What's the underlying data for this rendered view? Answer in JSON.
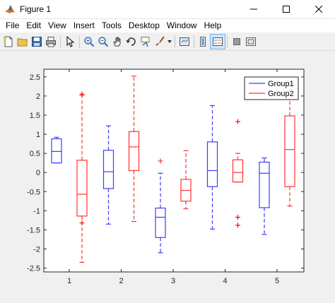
{
  "window": {
    "title": "Figure 1"
  },
  "menu": [
    "File",
    "Edit",
    "View",
    "Insert",
    "Tools",
    "Desktop",
    "Window",
    "Help"
  ],
  "toolbar": [
    "new-file-icon",
    "open-folder-icon",
    "save-icon",
    "print-icon",
    "pointer-icon",
    "zoom-in-icon",
    "zoom-out-icon",
    "pan-icon",
    "rotate-3d-icon",
    "data-cursor-icon",
    "brush-icon",
    "link-plot-icon",
    "colorbar-icon",
    "legend-icon",
    "hide-plot-tools-icon",
    "show-plot-tools-icon"
  ],
  "colors": {
    "group1": "#3c3cff",
    "group2": "#ff3333",
    "outlier2": "#ff0000"
  },
  "chart_data": {
    "type": "box",
    "xlabel": "",
    "ylabel": "",
    "categories": [
      "1",
      "2",
      "3",
      "4",
      "5"
    ],
    "ylim": [
      -2.6,
      2.7
    ],
    "yticks": [
      "-2.5",
      "-2",
      "-1.5",
      "-1",
      "-0.5",
      "0",
      "0.5",
      "1",
      "1.5",
      "2",
      "2.5"
    ],
    "yticks_values": [
      -2.5,
      -2,
      -1.5,
      -1,
      -0.5,
      0,
      0.5,
      1,
      1.5,
      2,
      2.5
    ],
    "legend": {
      "position": "top-right",
      "entries": [
        "Group1",
        "Group2"
      ]
    },
    "series": [
      {
        "name": "Group1",
        "boxes": [
          {
            "category": "1",
            "min": 0.25,
            "q1": 0.25,
            "median": 0.55,
            "q3": 0.88,
            "max": 0.92,
            "outliers": []
          },
          {
            "category": "2",
            "min": -1.35,
            "q1": -0.42,
            "median": 0.02,
            "q3": 0.58,
            "max": 1.22,
            "outliers": []
          },
          {
            "category": "3",
            "min": -2.1,
            "q1": -1.7,
            "median": -1.17,
            "q3": -0.93,
            "max": -0.02,
            "outliers": [
              0.3
            ]
          },
          {
            "category": "4",
            "min": -1.48,
            "q1": -0.37,
            "median": 0.05,
            "q3": 0.8,
            "max": 1.75,
            "outliers": []
          },
          {
            "category": "5",
            "min": -1.62,
            "q1": -0.92,
            "median": -0.02,
            "q3": 0.27,
            "max": 0.38,
            "outliers": []
          }
        ]
      },
      {
        "name": "Group2",
        "boxes": [
          {
            "category": "1",
            "min": -2.35,
            "q1": -1.14,
            "median": -0.57,
            "q3": 0.32,
            "max": 2.02,
            "outliers": [
              2.05,
              -1.32
            ]
          },
          {
            "category": "2",
            "min": -1.28,
            "q1": 0.05,
            "median": 0.67,
            "q3": 1.07,
            "max": 2.52,
            "outliers": []
          },
          {
            "category": "3",
            "min": -0.95,
            "q1": -0.75,
            "median": -0.47,
            "q3": -0.18,
            "max": 0.57,
            "outliers": []
          },
          {
            "category": "4",
            "min": -0.25,
            "q1": -0.25,
            "median": 0.0,
            "q3": 0.33,
            "max": 0.5,
            "outliers": [
              1.33,
              -1.17,
              -1.38
            ]
          },
          {
            "category": "5",
            "min": -0.88,
            "q1": -0.37,
            "median": 0.6,
            "q3": 1.48,
            "max": 1.92,
            "outliers": []
          }
        ]
      }
    ]
  }
}
